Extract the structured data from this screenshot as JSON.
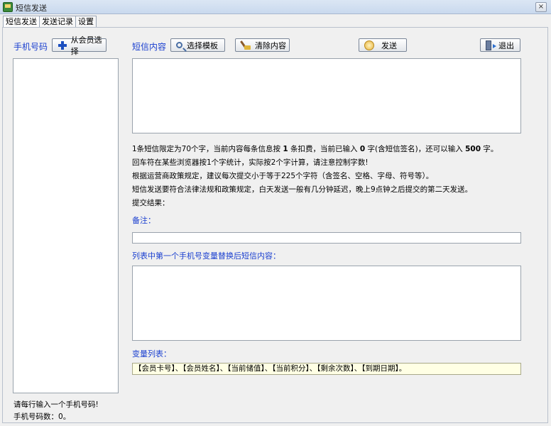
{
  "window": {
    "title": "短信发送",
    "close_glyph": "×"
  },
  "tabs": [
    {
      "label": "短信发送",
      "active": true
    },
    {
      "label": "发送记录",
      "active": false
    },
    {
      "label": "设置",
      "active": false
    }
  ],
  "left": {
    "phone_label": "手机号码",
    "select_member_button": "从会员选择",
    "hint": "请每行输入一个手机号码!",
    "count_label": "手机号码数：",
    "count_value": "0",
    "count_suffix": "。"
  },
  "sms": {
    "content_label": "短信内容",
    "template_button": "选择模板",
    "clear_button": "清除内容",
    "send_button": "发送",
    "exit_button": "退出"
  },
  "info": {
    "line1_a": "1条短信限定为70个字，当前内容每条信息按",
    "line1_count": "1",
    "line1_b": "条扣费，当前已输入",
    "line1_typed": "0",
    "line1_c": "字(含短信签名)，还可以输入",
    "line1_remaining": "500",
    "line1_d": "字。",
    "line2": "回车符在某些浏览器按1个字统计，实际按2个字计算，请注意控制字数!",
    "line3": "根据运营商政策规定，建议每次提交小于等于225个字符（含签名、空格、字母、符号等）。",
    "line4": "短信发送要符合法律法规和政策规定，白天发送一般有几分钟延迟，晚上9点钟之后提交的第二天发送。",
    "result_label": "提交结果："
  },
  "remark": {
    "label": "备注：",
    "value": ""
  },
  "preview": {
    "label": "列表中第一个手机号变量替换后短信内容："
  },
  "variables": {
    "label": "变量列表：",
    "items": "【会员卡号】、【会员姓名】、【当前储值】、【当前积分】、【剩余次数】、【到期日期】。"
  },
  "icons": {
    "plus": "plus-icon",
    "template": "search-icon",
    "clear": "broom-icon",
    "send": "send-icon",
    "exit": "exit-icon"
  }
}
